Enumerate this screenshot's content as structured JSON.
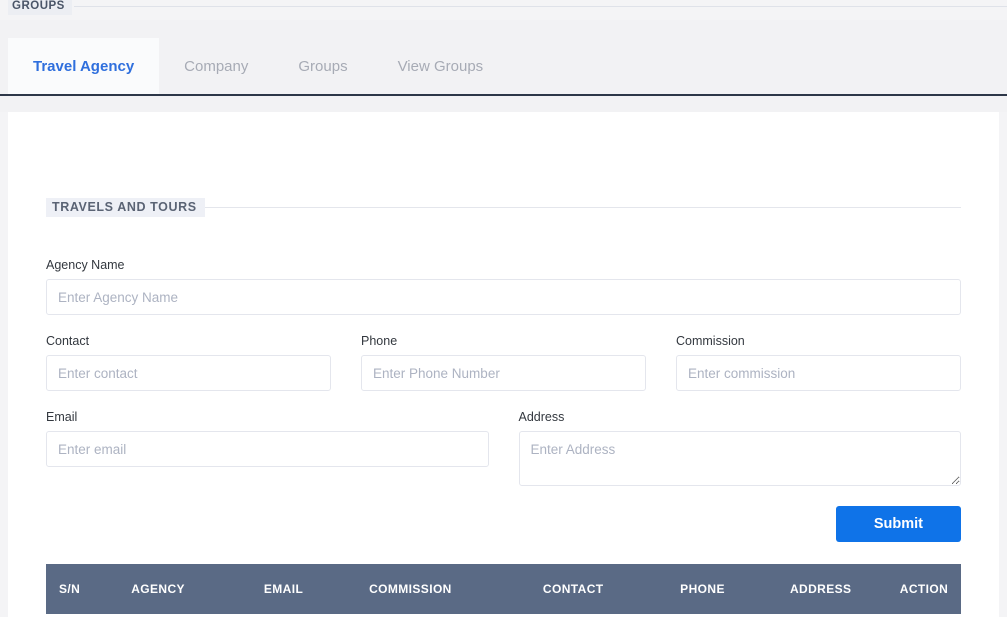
{
  "breadcrumb": {
    "title": "GROUPS"
  },
  "tabs": [
    {
      "label": "Travel Agency",
      "active": true
    },
    {
      "label": "Company",
      "active": false
    },
    {
      "label": "Groups",
      "active": false
    },
    {
      "label": "View Groups",
      "active": false
    }
  ],
  "form": {
    "section_title": "TRAVELS AND TOURS",
    "fields": {
      "agency_name": {
        "label": "Agency Name",
        "placeholder": "Enter Agency Name",
        "value": ""
      },
      "contact": {
        "label": "Contact",
        "placeholder": "Enter contact",
        "value": ""
      },
      "phone": {
        "label": "Phone",
        "placeholder": "Enter Phone Number",
        "value": ""
      },
      "commission": {
        "label": "Commission",
        "placeholder": "Enter commission",
        "value": ""
      },
      "email": {
        "label": "Email",
        "placeholder": "Enter email",
        "value": ""
      },
      "address": {
        "label": "Address",
        "placeholder": "Enter Address",
        "value": ""
      }
    },
    "submit_label": "Submit"
  },
  "table": {
    "headers": [
      "S/N",
      "AGENCY",
      "EMAIL",
      "COMMISSION",
      "CONTACT",
      "PHONE",
      "ADDRESS",
      "ACTION"
    ],
    "rows": []
  },
  "colors": {
    "accent_blue": "#0f73e8",
    "tab_active_text": "#2f6fdd",
    "tab_inactive_text": "#a7abb5",
    "tab_underline": "#2d3748",
    "table_header_bg": "#5a6a85",
    "section_title_text": "#5a6374",
    "placeholder": "#adb3c2"
  }
}
